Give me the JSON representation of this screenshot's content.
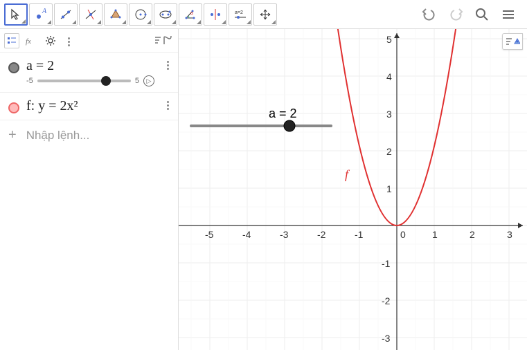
{
  "toolbar": {
    "tools": [
      "move",
      "point",
      "line",
      "perpendicular",
      "polygon",
      "circle",
      "ellipse",
      "angle",
      "reflect",
      "slider",
      "move-view"
    ]
  },
  "sidebar": {
    "input_placeholder": "Nhập lệnh...",
    "items": [
      {
        "id": "a",
        "label": "a = 2",
        "color": "gray",
        "min": "-5",
        "max": "5",
        "value": 2
      },
      {
        "id": "f",
        "label": "f: y = 2x²",
        "color": "red"
      }
    ]
  },
  "canvas": {
    "slider_label": "a = 2",
    "curve_label": "f",
    "x_ticks": [
      -5,
      -4,
      -3,
      -2,
      -1,
      0,
      1,
      2,
      3
    ],
    "y_ticks": [
      5,
      4,
      3,
      2,
      1,
      -1,
      -2,
      -3
    ]
  },
  "chart_data": {
    "type": "line",
    "title": "",
    "xlabel": "",
    "ylabel": "",
    "xlim": [
      -5.8,
      3.5
    ],
    "ylim": [
      -3.5,
      5.5
    ],
    "parameters": {
      "a": 2,
      "a_min": -5,
      "a_max": 5
    },
    "series": [
      {
        "name": "f",
        "expression": "y = 2x²",
        "color": "#e03030",
        "x": [
          -1.6,
          -1.4,
          -1.2,
          -1.0,
          -0.8,
          -0.6,
          -0.4,
          -0.2,
          0,
          0.2,
          0.4,
          0.6,
          0.8,
          1.0,
          1.2,
          1.4,
          1.6
        ],
        "y": [
          5.12,
          3.92,
          2.88,
          2.0,
          1.28,
          0.72,
          0.32,
          0.08,
          0,
          0.08,
          0.32,
          0.72,
          1.28,
          2.0,
          2.88,
          3.92,
          5.12
        ]
      }
    ]
  }
}
